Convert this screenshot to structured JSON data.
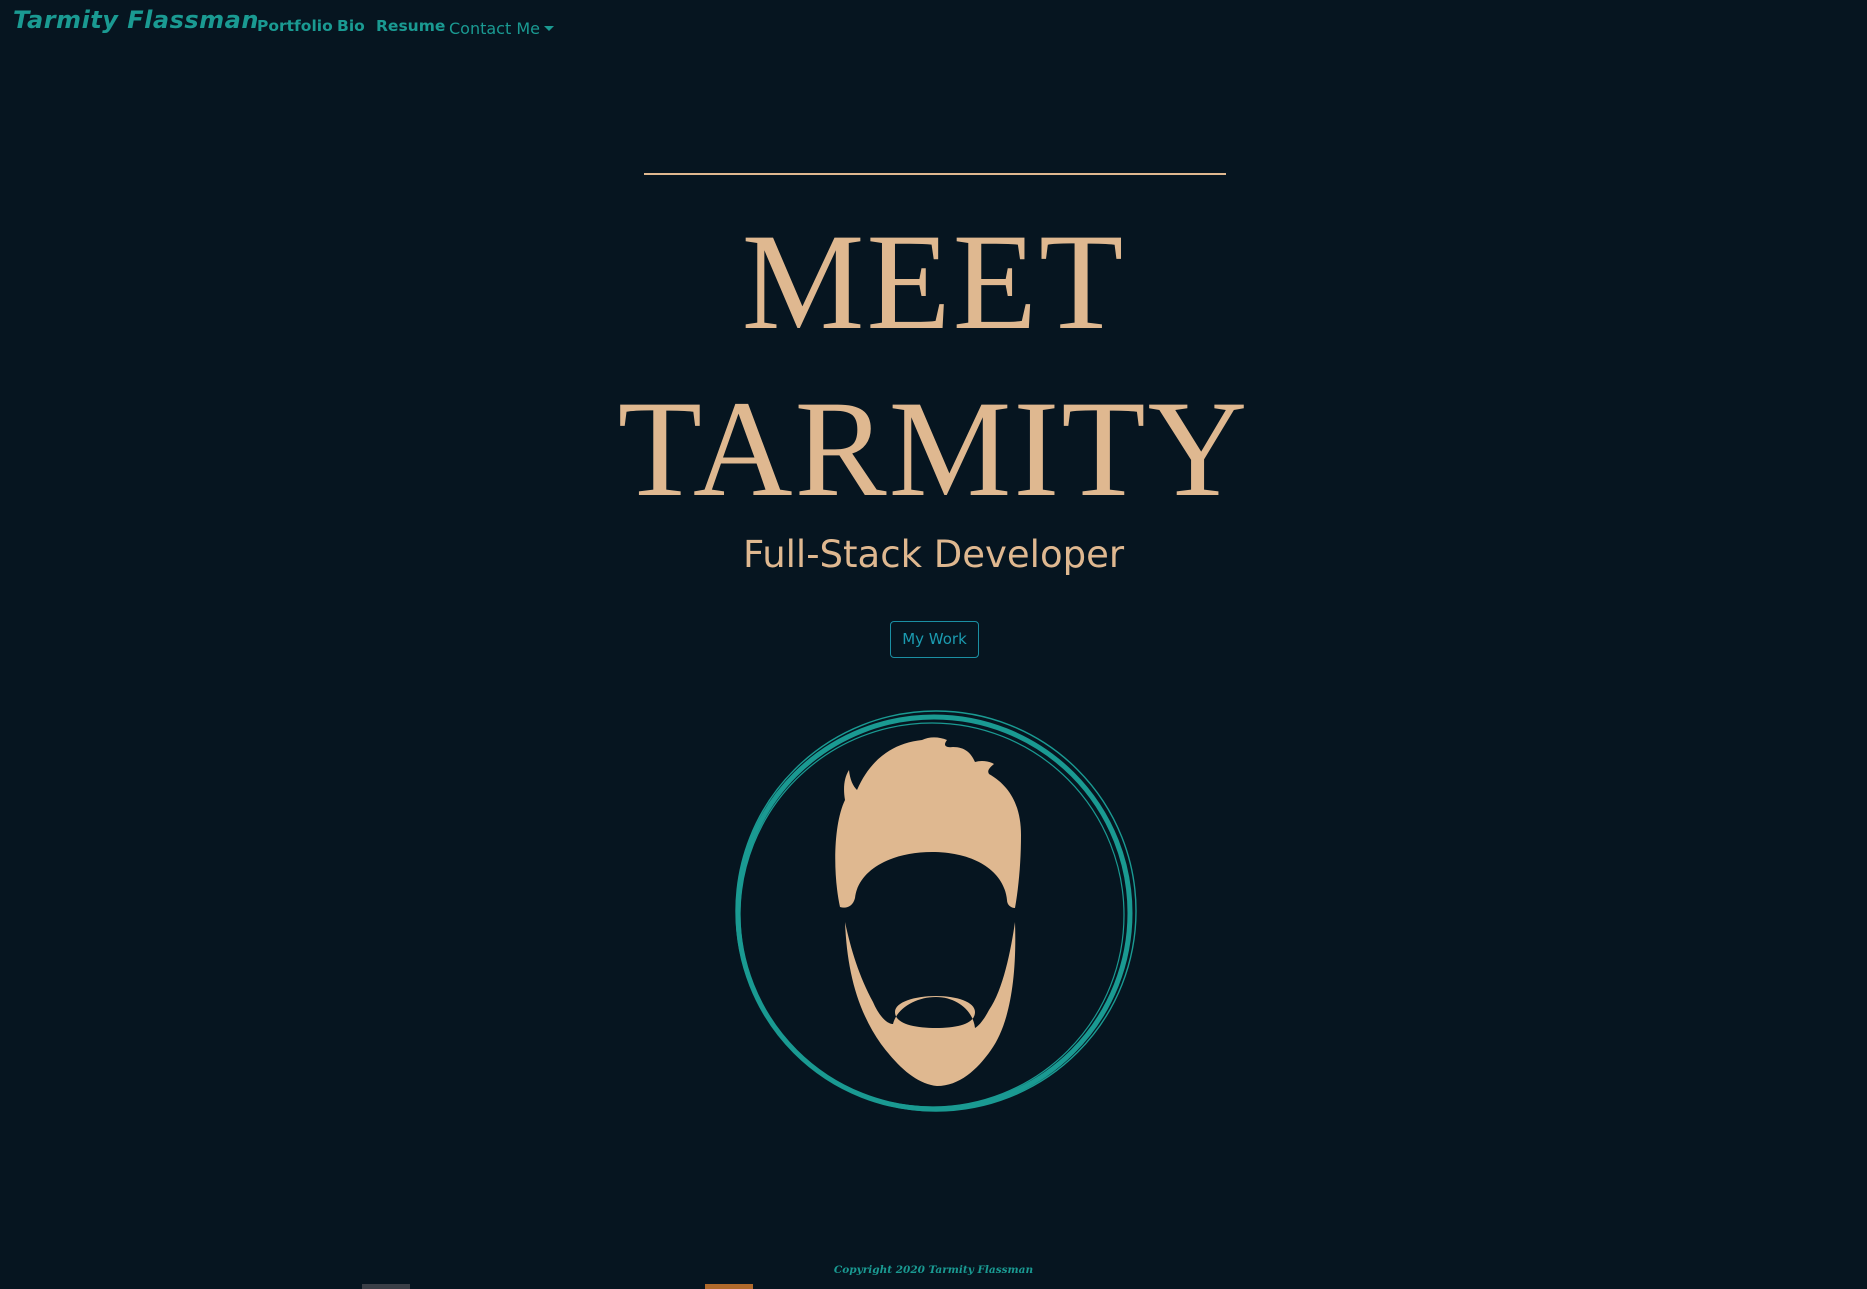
{
  "nav": {
    "brand": "Tarmity Flassman",
    "links": [
      {
        "label": "Portfolio"
      },
      {
        "label": "Bio"
      },
      {
        "label": "Resume"
      }
    ],
    "contact_label": "Contact Me"
  },
  "hero": {
    "line1": "MEET",
    "line2": "TARMITY",
    "subtitle": "Full-Stack Developer",
    "button_label": "My Work"
  },
  "footer": {
    "copyright": "Copyright 2020 Tarmity Flassman"
  },
  "colors": {
    "background": "#061520",
    "accent_teal": "#1a9a92",
    "accent_tan": "#dfb890",
    "button_blue": "#1b9bb0"
  },
  "icons": {
    "avatar": "bearded-man-avatar-icon",
    "dropdown": "chevron-down-icon"
  }
}
